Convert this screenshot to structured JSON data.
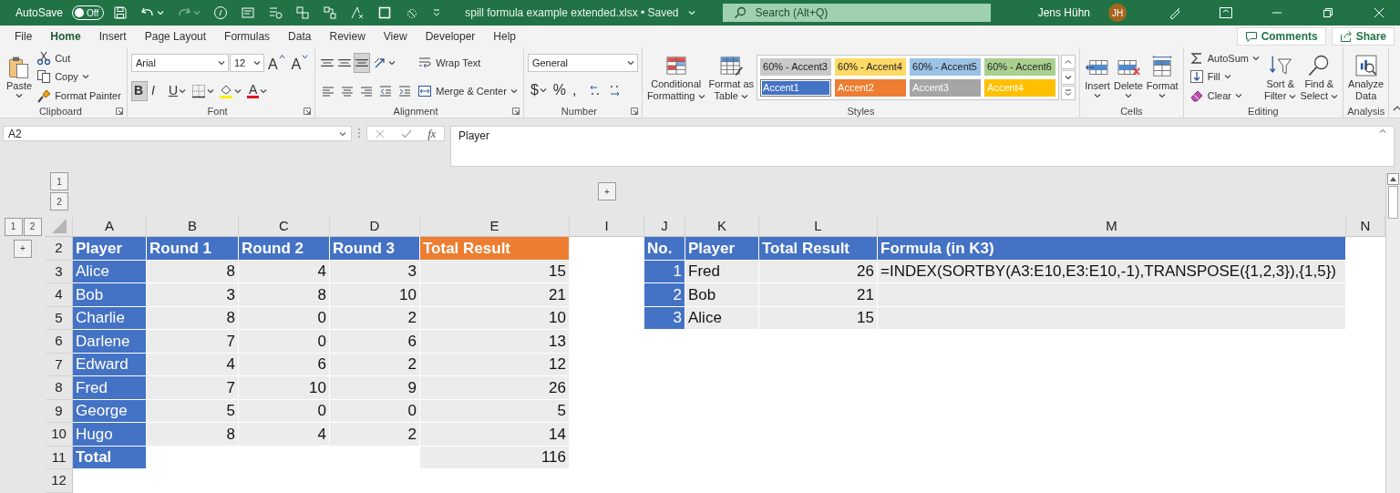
{
  "title_bar": {
    "autosave_label": "AutoSave",
    "autosave": {
      "label": "Off",
      "on": false
    },
    "title": "spill formula example extended.xlsx • Saved",
    "search": {
      "placeholder": "Search (Alt+Q)"
    },
    "user": "Jens Hühn",
    "avatar": "JH"
  },
  "ribbon": {
    "tabs": [
      {
        "label": "File",
        "selected": false
      },
      {
        "label": "Home",
        "selected": true
      },
      {
        "label": "Insert",
        "selected": false
      },
      {
        "label": "Page Layout",
        "selected": false
      },
      {
        "label": "Formulas",
        "selected": false
      },
      {
        "label": "Data",
        "selected": false
      },
      {
        "label": "Review",
        "selected": false
      },
      {
        "label": "View",
        "selected": false
      },
      {
        "label": "Developer",
        "selected": false
      },
      {
        "label": "Help",
        "selected": false
      }
    ],
    "actions": [
      {
        "label": "Comments"
      },
      {
        "label": "Share"
      }
    ],
    "groups": [
      {
        "name": "Clipboard",
        "launcher": true,
        "columns": [
          [
            [
              {
                "kind": "large",
                "label": "Paste",
                "caret": true
              }
            ]
          ],
          [
            [
              {
                "kind": "small",
                "label": "Cut"
              }
            ],
            [
              {
                "kind": "small",
                "label": "Copy",
                "caret": true
              }
            ],
            [
              {
                "kind": "small",
                "label": "Format Painter"
              }
            ]
          ]
        ]
      },
      {
        "name": "Font",
        "launcher": true,
        "columns": [
          [
            [
              {
                "kind": "select",
                "value": "Arial"
              },
              {
                "kind": "select",
                "value": "12"
              },
              {
                "kind": "grow",
                "label": "A"
              },
              {
                "kind": "shrink",
                "label": "A"
              }
            ],
            [
              {
                "kind": "bold",
                "label": "B",
                "selected": true
              },
              {
                "kind": "italic",
                "label": "I",
                "selected": false
              },
              {
                "kind": "underline",
                "label": "U",
                "selected": false,
                "caret": true
              },
              {
                "kind": "icon",
                "caret": true
              },
              {
                "kind": "icon",
                "caret": true
              },
              {
                "kind": "fontcolor",
                "label": "A",
                "caret": true
              }
            ]
          ]
        ]
      },
      {
        "name": "Alignment",
        "launcher": true,
        "columns": [
          [
            [
              {
                "kind": "icon",
                "selected": false
              },
              {
                "kind": "icon",
                "selected": false
              },
              {
                "kind": "icon",
                "selected": true
              },
              {
                "kind": "icon",
                "caret": true
              }
            ],
            [
              {
                "kind": "icon",
                "selected": false
              },
              {
                "kind": "icon",
                "selected": false
              },
              {
                "kind": "icon",
                "selected": false
              },
              {
                "kind": "icon"
              },
              {
                "kind": "icon"
              }
            ]
          ],
          [
            [
              {
                "kind": "small",
                "label": "Wrap Text"
              }
            ],
            [
              {
                "kind": "small",
                "label": "Merge & Center",
                "caret": true
              }
            ]
          ]
        ]
      },
      {
        "name": "Number",
        "launcher": true,
        "columns": [
          [
            [
              {
                "kind": "select",
                "value": "General"
              }
            ],
            [
              {
                "kind": "plain",
                "label": "$",
                "caret": true
              },
              {
                "kind": "plain",
                "label": "%"
              },
              {
                "kind": "plain",
                "label": ","
              },
              {
                "kind": "icon"
              },
              {
                "kind": "icon"
              }
            ]
          ]
        ]
      },
      {
        "name": "Styles",
        "columns": [
          [
            [
              {
                "kind": "large",
                "label": "Conditional Formatting",
                "caret": true
              }
            ]
          ],
          [
            [
              {
                "kind": "large",
                "label": "Format as Table",
                "caret": true
              }
            ]
          ],
          [
            [
              {
                "kind": "gallery",
                "styles": [
                  {
                    "label": "60% - Accent3",
                    "kind": "tint",
                    "color": "#c9c9c9",
                    "selected": false
                  },
                  {
                    "label": "60% - Accent4",
                    "kind": "tint",
                    "color": "#ffd966",
                    "selected": false
                  },
                  {
                    "label": "60% - Accent5",
                    "kind": "tint",
                    "color": "#9bc2e6",
                    "selected": false
                  },
                  {
                    "label": "60% - Accent6",
                    "kind": "tint",
                    "color": "#a9d08e",
                    "selected": false
                  },
                  {
                    "label": "Accent1",
                    "kind": "solid",
                    "color": "#4472c4",
                    "selected": true
                  },
                  {
                    "label": "Accent2",
                    "kind": "solid",
                    "color": "#ed7d31",
                    "selected": false
                  },
                  {
                    "label": "Accent3",
                    "kind": "solid",
                    "color": "#a5a5a5",
                    "selected": false
                  },
                  {
                    "label": "Accent4",
                    "kind": "solid",
                    "color": "#ffc000",
                    "selected": false
                  }
                ]
              }
            ]
          ]
        ]
      },
      {
        "name": "Cells",
        "columns": [
          [
            [
              {
                "kind": "large",
                "label": "Insert",
                "caret": true
              }
            ]
          ],
          [
            [
              {
                "kind": "large",
                "label": "Delete",
                "caret": true
              }
            ]
          ],
          [
            [
              {
                "kind": "large",
                "label": "Format",
                "caret": true
              }
            ]
          ]
        ]
      },
      {
        "name": "Editing",
        "columns": [
          [
            [
              {
                "kind": "small",
                "label": "AutoSum",
                "caret": true
              }
            ],
            [
              {
                "kind": "small",
                "label": "Fill",
                "caret": true
              }
            ],
            [
              {
                "kind": "small",
                "label": "Clear",
                "caret": true
              }
            ]
          ],
          [
            [
              {
                "kind": "large",
                "label": "Sort & Filter",
                "caret": true
              }
            ]
          ],
          [
            [
              {
                "kind": "large",
                "label": "Find & Select",
                "caret": true
              }
            ]
          ]
        ]
      },
      {
        "name": "Analysis",
        "columns": [
          [
            [
              {
                "kind": "large",
                "label": "Analyze Data"
              }
            ]
          ]
        ]
      }
    ]
  },
  "formula_bar": {
    "name_box": "A2",
    "fx": "fx",
    "formula": "Player"
  },
  "sheet": {
    "column_levels": [
      "1",
      "2"
    ],
    "row_levels": [
      "1",
      "2"
    ],
    "columns": [
      {
        "letter": "A"
      },
      {
        "letter": "B"
      },
      {
        "letter": "C"
      },
      {
        "letter": "D"
      },
      {
        "letter": "E"
      },
      {
        "letter": "I",
        "outline": "+"
      },
      {
        "letter": "J"
      },
      {
        "letter": "K"
      },
      {
        "letter": "L"
      },
      {
        "letter": "M"
      },
      {
        "letter": "N"
      }
    ],
    "rows": [
      {
        "number": "2",
        "outline": "+",
        "cells": [
          {
            "kind": "head",
            "color": "#4472c4",
            "text": "Player"
          },
          {
            "kind": "head",
            "color": "#4472c4",
            "text": "Round 1"
          },
          {
            "kind": "head",
            "color": "#4472c4",
            "text": "Round 2"
          },
          {
            "kind": "head",
            "color": "#4472c4",
            "text": "Round 3"
          },
          {
            "kind": "head",
            "color": "#ed7d31",
            "text": "Total Result"
          },
          {
            "kind": "blank"
          },
          {
            "kind": "head",
            "color": "#4472c4",
            "text": "No."
          },
          {
            "kind": "head",
            "color": "#4472c4",
            "text": "Player"
          },
          {
            "kind": "head",
            "color": "#4472c4",
            "text": "Total Result"
          },
          {
            "kind": "head",
            "color": "#4472c4",
            "text": "Formula (in K3)"
          },
          {
            "kind": "blank"
          }
        ]
      },
      {
        "number": "3",
        "cells": [
          {
            "kind": "label",
            "text": "Alice"
          },
          {
            "kind": "value",
            "text": "8"
          },
          {
            "kind": "value",
            "text": "4"
          },
          {
            "kind": "value",
            "text": "3"
          },
          {
            "kind": "value",
            "text": "15"
          },
          {
            "kind": "blank"
          },
          {
            "kind": "index",
            "text": "1"
          },
          {
            "kind": "name",
            "text": "Fred"
          },
          {
            "kind": "value",
            "text": "26"
          },
          {
            "kind": "name",
            "text": "=INDEX(SORTBY(A3:E10,E3:E10,-1),TRANSPOSE({1,2,3}),{1,5})"
          },
          {
            "kind": "blank"
          }
        ]
      },
      {
        "number": "4",
        "cells": [
          {
            "kind": "label",
            "text": "Bob"
          },
          {
            "kind": "value",
            "text": "3"
          },
          {
            "kind": "value",
            "text": "8"
          },
          {
            "kind": "value",
            "text": "10"
          },
          {
            "kind": "value",
            "text": "21"
          },
          {
            "kind": "blank"
          },
          {
            "kind": "index",
            "text": "2"
          },
          {
            "kind": "name",
            "text": "Bob"
          },
          {
            "kind": "value",
            "text": "21"
          },
          {
            "kind": "shade"
          },
          {
            "kind": "blank"
          }
        ]
      },
      {
        "number": "5",
        "cells": [
          {
            "kind": "label",
            "text": "Charlie"
          },
          {
            "kind": "value",
            "text": "8"
          },
          {
            "kind": "value",
            "text": "0"
          },
          {
            "kind": "value",
            "text": "2"
          },
          {
            "kind": "value",
            "text": "10"
          },
          {
            "kind": "blank"
          },
          {
            "kind": "index",
            "text": "3"
          },
          {
            "kind": "name",
            "text": "Alice"
          },
          {
            "kind": "value",
            "text": "15"
          },
          {
            "kind": "shade"
          },
          {
            "kind": "blank"
          }
        ]
      },
      {
        "number": "6",
        "cells": [
          {
            "kind": "label",
            "text": "Darlene"
          },
          {
            "kind": "value",
            "text": "7"
          },
          {
            "kind": "value",
            "text": "0"
          },
          {
            "kind": "value",
            "text": "6"
          },
          {
            "kind": "value",
            "text": "13"
          },
          {
            "kind": "blank"
          },
          {
            "kind": "blank"
          },
          {
            "kind": "blank"
          },
          {
            "kind": "blank"
          },
          {
            "kind": "blank"
          },
          {
            "kind": "blank"
          }
        ]
      },
      {
        "number": "7",
        "cells": [
          {
            "kind": "label",
            "text": "Edward"
          },
          {
            "kind": "value",
            "text": "4"
          },
          {
            "kind": "value",
            "text": "6"
          },
          {
            "kind": "value",
            "text": "2"
          },
          {
            "kind": "value",
            "text": "12"
          },
          {
            "kind": "blank"
          },
          {
            "kind": "blank"
          },
          {
            "kind": "blank"
          },
          {
            "kind": "blank"
          },
          {
            "kind": "blank"
          },
          {
            "kind": "blank"
          }
        ]
      },
      {
        "number": "8",
        "cells": [
          {
            "kind": "label",
            "text": "Fred"
          },
          {
            "kind": "value",
            "text": "7"
          },
          {
            "kind": "value",
            "text": "10"
          },
          {
            "kind": "value",
            "text": "9"
          },
          {
            "kind": "value",
            "text": "26"
          },
          {
            "kind": "blank"
          },
          {
            "kind": "blank"
          },
          {
            "kind": "blank"
          },
          {
            "kind": "blank"
          },
          {
            "kind": "blank"
          },
          {
            "kind": "blank"
          }
        ]
      },
      {
        "number": "9",
        "cells": [
          {
            "kind": "label",
            "text": "George"
          },
          {
            "kind": "value",
            "text": "5"
          },
          {
            "kind": "value",
            "text": "0"
          },
          {
            "kind": "value",
            "text": "0"
          },
          {
            "kind": "value",
            "text": "5"
          },
          {
            "kind": "blank"
          },
          {
            "kind": "blank"
          },
          {
            "kind": "blank"
          },
          {
            "kind": "blank"
          },
          {
            "kind": "blank"
          },
          {
            "kind": "blank"
          }
        ]
      },
      {
        "number": "10",
        "cells": [
          {
            "kind": "label",
            "text": "Hugo"
          },
          {
            "kind": "value",
            "text": "8"
          },
          {
            "kind": "value",
            "text": "4"
          },
          {
            "kind": "value",
            "text": "2"
          },
          {
            "kind": "value",
            "text": "14"
          },
          {
            "kind": "blank"
          },
          {
            "kind": "blank"
          },
          {
            "kind": "blank"
          },
          {
            "kind": "blank"
          },
          {
            "kind": "blank"
          },
          {
            "kind": "blank"
          }
        ]
      },
      {
        "number": "11",
        "cells": [
          {
            "kind": "total",
            "text": "Total"
          },
          {
            "kind": "blank"
          },
          {
            "kind": "blank"
          },
          {
            "kind": "blank"
          },
          {
            "kind": "value",
            "text": "116"
          },
          {
            "kind": "blank"
          },
          {
            "kind": "blank"
          },
          {
            "kind": "blank"
          },
          {
            "kind": "blank"
          },
          {
            "kind": "blank"
          },
          {
            "kind": "blank"
          }
        ]
      },
      {
        "number": "12",
        "cells": [
          {
            "kind": "blank"
          },
          {
            "kind": "blank"
          },
          {
            "kind": "blank"
          },
          {
            "kind": "blank"
          },
          {
            "kind": "blank"
          },
          {
            "kind": "blank"
          },
          {
            "kind": "blank"
          },
          {
            "kind": "blank"
          },
          {
            "kind": "blank"
          },
          {
            "kind": "blank"
          },
          {
            "kind": "blank"
          }
        ]
      }
    ]
  }
}
